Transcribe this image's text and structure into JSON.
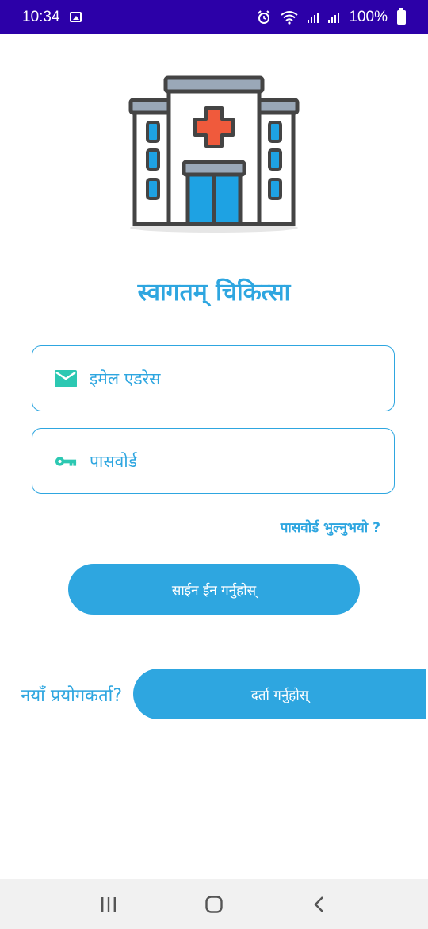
{
  "status_bar": {
    "time": "10:34",
    "battery": "100%"
  },
  "icons": {
    "gallery": "gallery-icon",
    "alarm": "alarm-icon",
    "wifi": "wifi-icon",
    "signal": "signal-icon",
    "battery": "battery-icon",
    "logo": "hospital-icon",
    "email": "email-icon",
    "password": "key-icon",
    "recents": "recents-icon",
    "home": "home-icon",
    "back": "back-icon"
  },
  "app": {
    "title": "स्वागतम् चिकित्सा"
  },
  "login": {
    "email_placeholder": "इमेल एडरेस",
    "email_value": "",
    "password_placeholder": "पासवोर्ड",
    "password_value": "",
    "forgot_label": "पासवोर्ड भुल्नुभयो ?",
    "signin_label": "साईन ईन गर्नुहोस्"
  },
  "register": {
    "prompt": "नयाँ प्रयोगकर्ता?",
    "button_label": "दर्ता गर्नुहोस्"
  },
  "colors": {
    "accent": "#2ea6e0",
    "status_bar": "#2c00a8",
    "cross": "#f05a3c",
    "window": "#1ea2e3",
    "input_icon": "#2cc8b2"
  }
}
